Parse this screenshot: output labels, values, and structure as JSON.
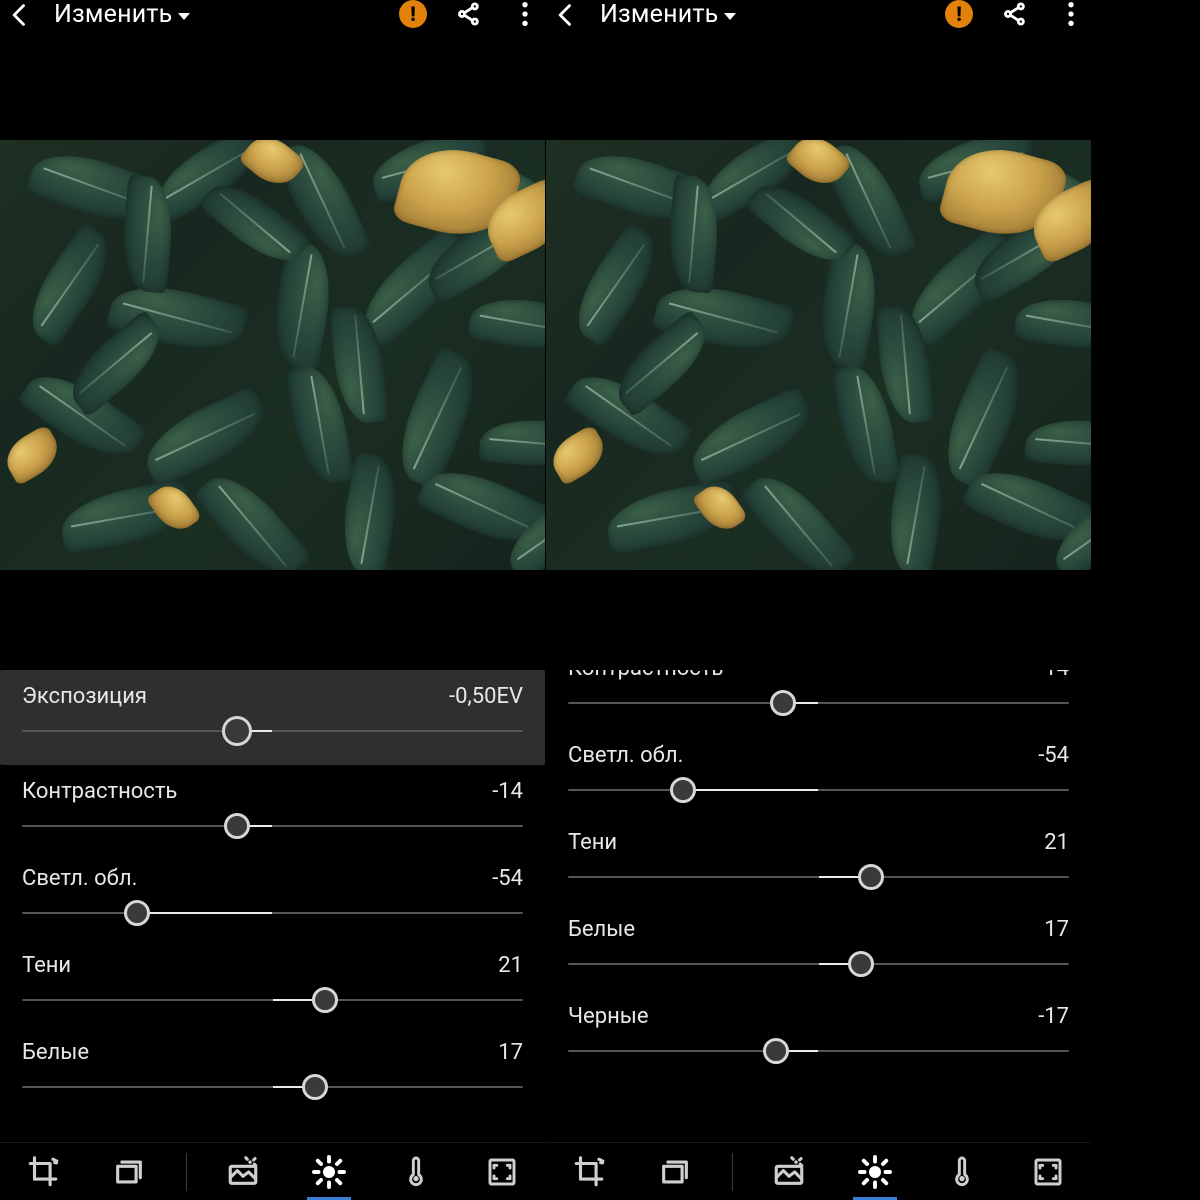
{
  "header": {
    "title": "Изменить"
  },
  "sliders": {
    "exposure": {
      "label": "Экспозиция",
      "display": "-0,50EV",
      "value": -0.5,
      "pct": 43,
      "min": -5,
      "max": 5
    },
    "contrast": {
      "label": "Контрастность",
      "display": "-14",
      "value": -14,
      "pct": 43,
      "min": -100,
      "max": 100
    },
    "highlights": {
      "label": "Светл. обл.",
      "display": "-54",
      "value": -54,
      "pct": 23,
      "min": -100,
      "max": 100
    },
    "shadows": {
      "label": "Тени",
      "display": "21",
      "value": 21,
      "pct": 60.5,
      "min": -100,
      "max": 100
    },
    "whites": {
      "label": "Белые",
      "display": "17",
      "value": 17,
      "pct": 58.5,
      "min": -100,
      "max": 100
    },
    "blacks": {
      "label": "Черные",
      "display": "-17",
      "value": -17,
      "pct": 41.5,
      "min": -100,
      "max": 100
    }
  },
  "toolbar": {
    "items": [
      "crop",
      "presets",
      "heal",
      "light",
      "color",
      "fullscreen"
    ],
    "active": "light"
  },
  "panes": {
    "left": {
      "highlightKey": "exposure",
      "order": [
        "exposure",
        "contrast",
        "highlights",
        "shadows",
        "whites"
      ],
      "scrollOffset": 0
    },
    "right": {
      "highlightKey": null,
      "order": [
        "contrast",
        "highlights",
        "shadows",
        "whites",
        "blacks"
      ],
      "scrollOffset": -28
    }
  }
}
